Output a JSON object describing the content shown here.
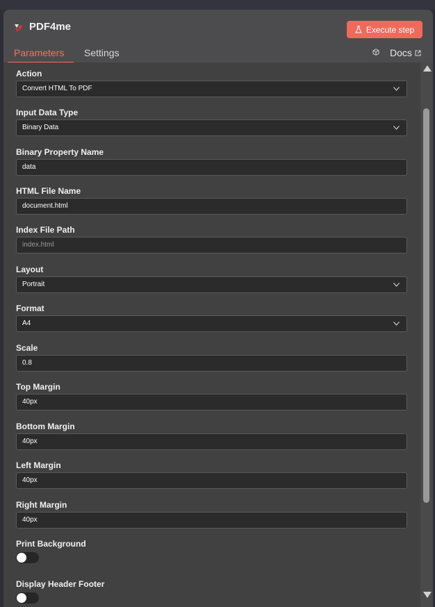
{
  "app": {
    "title": "PDF4me"
  },
  "header": {
    "execute_label": "Execute step",
    "docs_label": "Docs"
  },
  "tabs": [
    {
      "label": "Parameters",
      "active": true
    },
    {
      "label": "Settings",
      "active": false
    }
  ],
  "fields": {
    "action": {
      "label": "Action",
      "value": "Convert HTML To PDF"
    },
    "input_data_type": {
      "label": "Input Data Type",
      "value": "Binary Data"
    },
    "binary_property_name": {
      "label": "Binary Property Name",
      "value": "data"
    },
    "html_file_name": {
      "label": "HTML File Name",
      "value": "document.html"
    },
    "index_file_path": {
      "label": "Index File Path",
      "placeholder": "index.html"
    },
    "layout": {
      "label": "Layout",
      "value": "Portrait"
    },
    "format": {
      "label": "Format",
      "value": "A4"
    },
    "scale": {
      "label": "Scale",
      "value": "0.8"
    },
    "top_margin": {
      "label": "Top Margin",
      "value": "40px"
    },
    "bottom_margin": {
      "label": "Bottom Margin",
      "value": "40px"
    },
    "left_margin": {
      "label": "Left Margin",
      "value": "40px"
    },
    "right_margin": {
      "label": "Right Margin",
      "value": "40px"
    },
    "print_background": {
      "label": "Print Background",
      "enabled": false
    },
    "display_header_footer": {
      "label": "Display Header Footer",
      "enabled": false
    }
  },
  "colors": {
    "accent": "#ff6d5a",
    "execute_bg": "#ef6a5a",
    "panel_bg": "#414141",
    "input_bg": "#2b2b2b"
  },
  "icons": {
    "logo": "pdf4me-logo-icon",
    "execute": "flask-icon",
    "node": "cube-icon",
    "docs": "external-link-icon",
    "select": "chevron-down-icon"
  }
}
